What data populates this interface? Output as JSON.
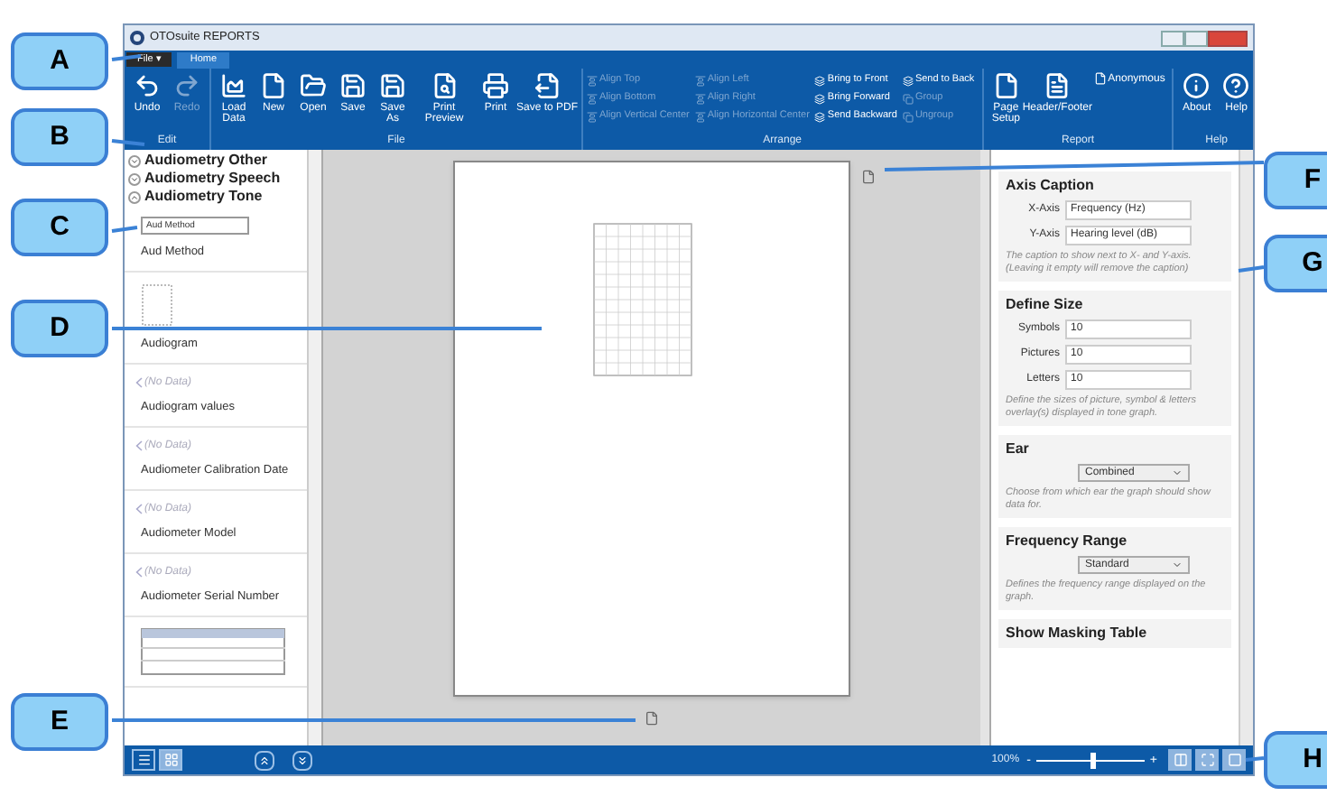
{
  "window": {
    "title": "OTOsuite REPORTS"
  },
  "file_button": {
    "label": "File ▾"
  },
  "tabs": [
    {
      "label": "Home",
      "selected": true
    }
  ],
  "ribbon": [
    {
      "group": "Edit",
      "kind": "large",
      "buttons": [
        {
          "label": "Undo",
          "disabled": false
        },
        {
          "label": "Redo",
          "disabled": true
        }
      ]
    },
    {
      "group": "File",
      "kind": "large",
      "buttons": [
        {
          "label": "Load Data",
          "disabled": false
        },
        {
          "label": "New",
          "disabled": false
        },
        {
          "label": "Open",
          "disabled": false
        },
        {
          "label": "Save",
          "disabled": false
        },
        {
          "label": "Save As",
          "disabled": false
        },
        {
          "label": "Print Preview",
          "disabled": false
        },
        {
          "label": "Print",
          "disabled": false
        },
        {
          "label": "Save to PDF",
          "disabled": false
        }
      ]
    },
    {
      "group": "Arrange",
      "kind": "small",
      "columns": [
        [
          {
            "label": "Align Top",
            "disabled": true
          },
          {
            "label": "Align Bottom",
            "disabled": true
          },
          {
            "label": "Align Vertical Center",
            "disabled": true
          }
        ],
        [
          {
            "label": "Align Left",
            "disabled": true
          },
          {
            "label": "Align Right",
            "disabled": true
          },
          {
            "label": "Align Horizontal Center",
            "disabled": true
          }
        ],
        [
          {
            "label": "Bring to Front",
            "disabled": false
          },
          {
            "label": "Bring Forward",
            "disabled": false
          },
          {
            "label": "Send Backward",
            "disabled": false
          }
        ],
        [
          {
            "label": "Send to Back",
            "disabled": false
          },
          {
            "label": "Group",
            "disabled": true
          },
          {
            "label": "Ungroup",
            "disabled": true
          }
        ]
      ]
    },
    {
      "group": "Report",
      "kind": "large",
      "buttons": [
        {
          "label": "Page Setup",
          "kind": "large",
          "disabled": false
        },
        {
          "label": "Header/Footer",
          "kind": "large",
          "disabled": false
        },
        {
          "label": "Anonymous",
          "kind": "small",
          "disabled": false
        }
      ]
    },
    {
      "group": "Help",
      "kind": "large",
      "buttons": [
        {
          "label": "About",
          "disabled": false
        },
        {
          "label": "Help",
          "disabled": false
        }
      ]
    }
  ],
  "categories": [
    {
      "label": "Audiometry Other",
      "expanded": false
    },
    {
      "label": "Audiometry Speech",
      "expanded": false
    },
    {
      "label": "Audiometry Tone",
      "expanded": true
    }
  ],
  "elements": [
    {
      "kind": "field",
      "preview": "Aud Method",
      "label": "Aud Method"
    },
    {
      "kind": "graph",
      "label": "Audiogram"
    },
    {
      "kind": "nodata",
      "preview": "(No Data)",
      "label": "Audiogram values"
    },
    {
      "kind": "nodata",
      "preview": "(No Data)",
      "label": "Audiometer Calibration Date"
    },
    {
      "kind": "nodata",
      "preview": "(No Data)",
      "label": "Audiometer Model"
    },
    {
      "kind": "nodata",
      "preview": "(No Data)",
      "label": "Audiometer Serial Number"
    },
    {
      "kind": "table"
    }
  ],
  "properties": [
    {
      "title": "Axis Caption",
      "fields": [
        {
          "label": "X-Axis",
          "value": "Frequency (Hz)"
        },
        {
          "label": "Y-Axis",
          "value": "Hearing level (dB)"
        }
      ],
      "description": "The caption to show next to X- and Y-axis.(Leaving it empty will remove the caption)"
    },
    {
      "title": "Define Size",
      "fields": [
        {
          "label": "Symbols",
          "value": "10"
        },
        {
          "label": "Pictures",
          "value": "10"
        },
        {
          "label": "Letters",
          "value": "10"
        }
      ],
      "description": "Define the sizes of picture, symbol & letters overlay(s) displayed in tone graph."
    },
    {
      "title": "Ear",
      "select": "Combined",
      "description": "Choose from which ear the graph should show data for."
    },
    {
      "title": "Frequency Range",
      "select": "Standard",
      "description": "Defines the frequency range displayed on the graph."
    },
    {
      "title": "Show Masking Table"
    }
  ],
  "status_bar": {
    "zoom": "100%",
    "minus": "-",
    "plus": "+",
    "zoom_slider": {
      "level": 0.52
    },
    "views": [
      {
        "selected": false
      },
      {
        "selected": true
      }
    ]
  },
  "callouts": [
    "A",
    "B",
    "C",
    "D",
    "E",
    "F",
    "G",
    "H"
  ]
}
